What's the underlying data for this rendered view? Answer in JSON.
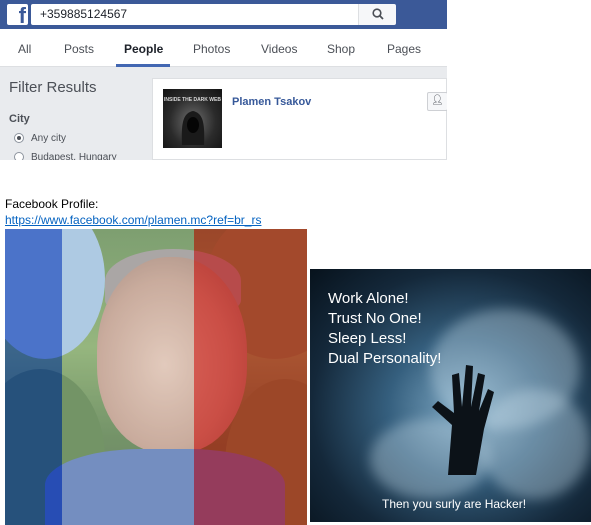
{
  "facebook": {
    "search": {
      "value": "+359885124567",
      "button_icon": "search-icon"
    },
    "logo_letter": "f",
    "tabs": [
      {
        "label": "All",
        "active": false
      },
      {
        "label": "Posts",
        "active": false
      },
      {
        "label": "People",
        "active": true
      },
      {
        "label": "Photos",
        "active": false
      },
      {
        "label": "Videos",
        "active": false
      },
      {
        "label": "Shop",
        "active": false
      },
      {
        "label": "Pages",
        "active": false
      }
    ],
    "filter": {
      "title": "Filter Results",
      "city_label": "City",
      "options": [
        {
          "label": "Any city",
          "selected": true
        },
        {
          "label": "Budapest, Hungary",
          "selected": false
        }
      ]
    },
    "result": {
      "name": "Plamen Tsakov",
      "thumbnail_text": "INSIDE THE DARK WEB",
      "add_friend_icon": "add-friend-icon"
    },
    "colors": {
      "brand": "#3b5998",
      "link": "#365899"
    }
  },
  "caption": {
    "label": "Facebook Profile:",
    "url": "https://www.facebook.com/plamen.mc?ref=br_rs"
  },
  "hacker_poster": {
    "lines": [
      "Work Alone!",
      "Trust No One!",
      "Sleep Less!",
      "Dual Personality!"
    ],
    "footer": "Then you surly are Hacker!"
  }
}
